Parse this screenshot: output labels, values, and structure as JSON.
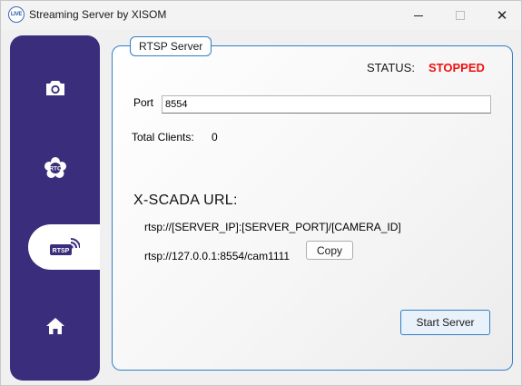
{
  "window": {
    "title": "Streaming Server by XISOM",
    "app_icon_text": "LIVE",
    "controls": {
      "minimize": "—",
      "maximize": "☐",
      "close": "✕"
    }
  },
  "sidebar": {
    "accent_color": "#3a2e7c",
    "items": [
      {
        "id": "camera",
        "icon": "camera-icon",
        "active": false
      },
      {
        "id": "rtc",
        "icon": "rtc-icon",
        "icon_text": "RTC",
        "active": false
      },
      {
        "id": "rtsp",
        "icon": "rtsp-icon",
        "icon_text": "RTSP",
        "active": true
      },
      {
        "id": "home",
        "icon": "home-icon",
        "active": false
      }
    ]
  },
  "rtsp_server": {
    "group_title": "RTSP Server",
    "status_label": "STATUS:",
    "status_value": "STOPPED",
    "status_color": "#ee1111",
    "port_label": "Port",
    "port_value": "8554",
    "total_clients_label": "Total Clients:",
    "total_clients_value": "0",
    "xscada_label": "X-SCADA URL:",
    "url_template": "rtsp://[SERVER_IP]:[SERVER_PORT]/[CAMERA_ID]",
    "url_actual": "rtsp://127.0.0.1:8554/cam1111",
    "copy_label": "Copy",
    "start_label": "Start Server"
  }
}
